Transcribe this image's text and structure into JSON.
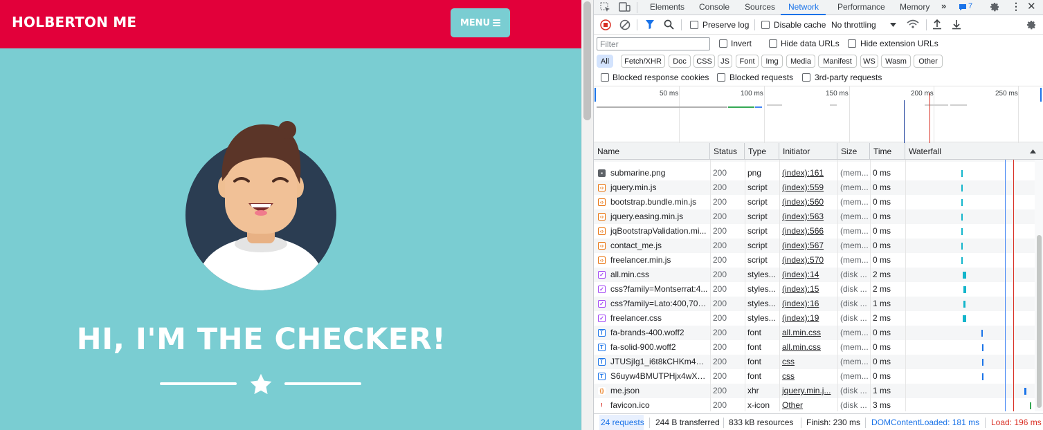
{
  "site": {
    "brand": "HOLBERTON ME",
    "menu_label": "MENU",
    "hero_title": "HI, I'M THE CHECKER!",
    "colors": {
      "nav": "#e2003a",
      "background": "#7acdd2"
    }
  },
  "devtools": {
    "tabs": [
      "Elements",
      "Console",
      "Sources",
      "Network",
      "Performance",
      "Memory"
    ],
    "active_tab": "Network",
    "issues_count": "7",
    "toolbar": {
      "preserve_log": "Preserve log",
      "disable_cache": "Disable cache",
      "throttling": "No throttling"
    },
    "filter": {
      "placeholder": "Filter",
      "invert": "Invert",
      "hide_data_urls": "Hide data URLs",
      "hide_extension_urls": "Hide extension URLs"
    },
    "type_filters": [
      "All",
      "Fetch/XHR",
      "Doc",
      "CSS",
      "JS",
      "Font",
      "Img",
      "Media",
      "Manifest",
      "WS",
      "Wasm",
      "Other"
    ],
    "blocked": {
      "cookies": "Blocked response cookies",
      "requests": "Blocked requests",
      "third_party": "3rd-party requests"
    },
    "timeline_ticks": [
      "50 ms",
      "100 ms",
      "150 ms",
      "200 ms",
      "250 ms"
    ],
    "columns": [
      "Name",
      "Status",
      "Type",
      "Initiator",
      "Size",
      "Time",
      "Waterfall"
    ],
    "rows": [
      {
        "name": "submarine.png",
        "status": "200",
        "type": "png",
        "initiator": "(index):161",
        "size": "(mem...",
        "time": "0 ms",
        "icon": "image-icon"
      },
      {
        "name": "jquery.min.js",
        "status": "200",
        "type": "script",
        "initiator": "(index):559",
        "size": "(mem...",
        "time": "0 ms",
        "icon": "script-icon"
      },
      {
        "name": "bootstrap.bundle.min.js",
        "status": "200",
        "type": "script",
        "initiator": "(index):560",
        "size": "(mem...",
        "time": "0 ms",
        "icon": "script-icon"
      },
      {
        "name": "jquery.easing.min.js",
        "status": "200",
        "type": "script",
        "initiator": "(index):563",
        "size": "(mem...",
        "time": "0 ms",
        "icon": "script-icon"
      },
      {
        "name": "jqBootstrapValidation.mi...",
        "status": "200",
        "type": "script",
        "initiator": "(index):566",
        "size": "(mem...",
        "time": "0 ms",
        "icon": "script-icon"
      },
      {
        "name": "contact_me.js",
        "status": "200",
        "type": "script",
        "initiator": "(index):567",
        "size": "(mem...",
        "time": "0 ms",
        "icon": "script-icon"
      },
      {
        "name": "freelancer.min.js",
        "status": "200",
        "type": "script",
        "initiator": "(index):570",
        "size": "(mem...",
        "time": "0 ms",
        "icon": "script-icon"
      },
      {
        "name": "all.min.css",
        "status": "200",
        "type": "styles...",
        "initiator": "(index):14",
        "size": "(disk ...",
        "time": "2 ms",
        "icon": "stylesheet-icon"
      },
      {
        "name": "css?family=Montserrat:4...",
        "status": "200",
        "type": "styles...",
        "initiator": "(index):15",
        "size": "(disk ...",
        "time": "2 ms",
        "icon": "stylesheet-icon"
      },
      {
        "name": "css?family=Lato:400,700...",
        "status": "200",
        "type": "styles...",
        "initiator": "(index):16",
        "size": "(disk ...",
        "time": "1 ms",
        "icon": "stylesheet-icon"
      },
      {
        "name": "freelancer.css",
        "status": "200",
        "type": "styles...",
        "initiator": "(index):19",
        "size": "(disk ...",
        "time": "2 ms",
        "icon": "stylesheet-icon"
      },
      {
        "name": "fa-brands-400.woff2",
        "status": "200",
        "type": "font",
        "initiator": "all.min.css",
        "size": "(mem...",
        "time": "0 ms",
        "icon": "font-icon"
      },
      {
        "name": "fa-solid-900.woff2",
        "status": "200",
        "type": "font",
        "initiator": "all.min.css",
        "size": "(mem...",
        "time": "0 ms",
        "icon": "font-icon"
      },
      {
        "name": "JTUSjIg1_i6t8kCHKm459...",
        "status": "200",
        "type": "font",
        "initiator": "css",
        "size": "(mem...",
        "time": "0 ms",
        "icon": "font-icon"
      },
      {
        "name": "S6uyw4BMUTPHjx4wXg...",
        "status": "200",
        "type": "font",
        "initiator": "css",
        "size": "(mem...",
        "time": "0 ms",
        "icon": "font-icon"
      },
      {
        "name": "me.json",
        "status": "200",
        "type": "xhr",
        "initiator": "jquery.min.j...",
        "size": "(disk ...",
        "time": "1 ms",
        "icon": "xhr-icon"
      },
      {
        "name": "favicon.ico",
        "status": "200",
        "type": "x-icon",
        "initiator": "Other",
        "size": "(disk ...",
        "time": "3 ms",
        "icon": "favicon-icon"
      }
    ],
    "status": {
      "requests": "24 requests",
      "transferred": "244 B transferred",
      "resources": "833 kB resources",
      "finish": "Finish: 230 ms",
      "dom_content_loaded": "DOMContentLoaded: 181 ms",
      "load": "Load: 196 ms"
    }
  }
}
